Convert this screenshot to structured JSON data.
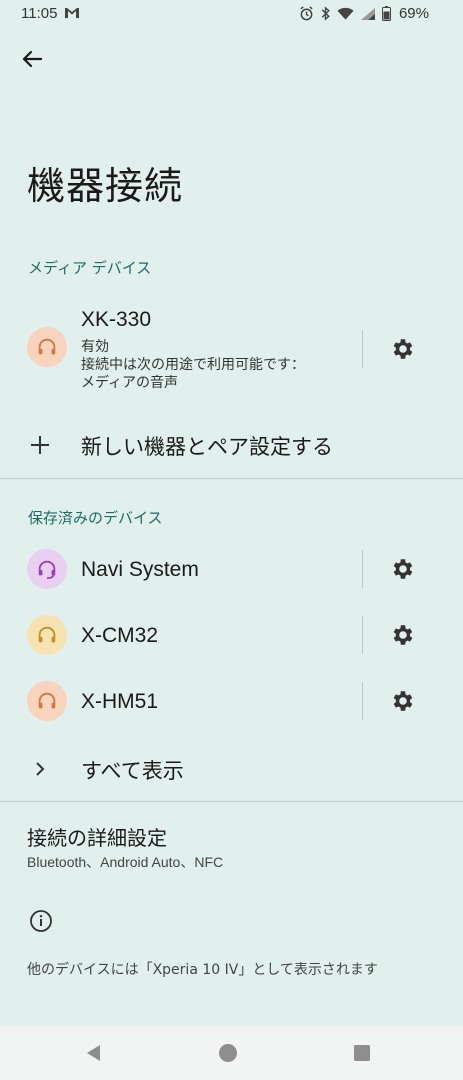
{
  "status_bar": {
    "time": "11:05",
    "battery": "69%"
  },
  "header": {
    "title": "機器接続"
  },
  "media_section": {
    "title": "メディア デバイス",
    "device": {
      "name": "XK-330",
      "status": "有効",
      "line2": "接続中は次の用途で利用可能です：",
      "line3": "メディアの音声",
      "icon": "headphones-icon",
      "avatar_color": "#f8d3bd"
    },
    "pair_label": "新しい機器とペア設定する"
  },
  "saved_section": {
    "title": "保存済みのデバイス",
    "devices": [
      {
        "name": "Navi System",
        "icon": "headset-icon",
        "avatar_color": "#ead0f0"
      },
      {
        "name": "X-CM32",
        "icon": "headphones-icon",
        "avatar_color": "#f7e3b1"
      },
      {
        "name": "X-HM51",
        "icon": "headphones-icon",
        "avatar_color": "#f8d3bd"
      }
    ],
    "show_all_label": "すべて表示"
  },
  "advanced": {
    "title": "接続の詳細設定",
    "subtitle": "Bluetooth、Android Auto、NFC"
  },
  "footer": {
    "text": "他のデバイスには「Xperia 10 IV」として表示されます"
  },
  "colors": {
    "background": "#e1f0ec",
    "accent": "#1d6b63"
  }
}
